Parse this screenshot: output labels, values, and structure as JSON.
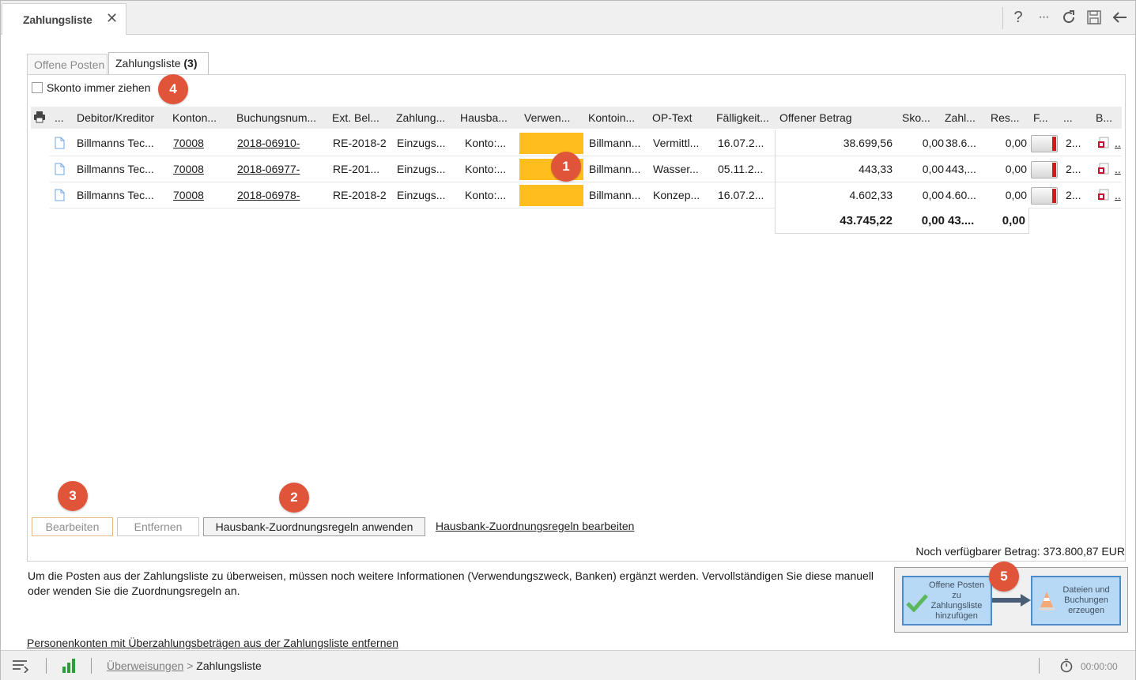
{
  "doc_tab": {
    "title": "Zahlungsliste",
    "close": "✕"
  },
  "toolbar": {
    "help": "?",
    "more": "···"
  },
  "inner_tabs": [
    {
      "label": "Offene Posten"
    },
    {
      "label": "Zahlungsliste",
      "count": "(3)"
    }
  ],
  "skonto_checkbox": {
    "label": "Skonto immer ziehen",
    "checked": false
  },
  "badges": [
    "1",
    "2",
    "3",
    "4",
    "5"
  ],
  "grid": {
    "columns": [
      "...",
      "Debitor/Kreditor",
      "Konton...",
      "Buchungsnum...",
      "Ext. Bel...",
      "Zahlung...",
      "Hausba...",
      "Verwen...",
      "Kontoin...",
      "OP-Text",
      "Fälligkeit...",
      "Offener Betrag",
      "Sko...",
      "Zahl...",
      "Res...",
      "F...",
      "...",
      "B..."
    ],
    "rows": [
      {
        "debitor": "Billmanns Tec...",
        "konto": "70008",
        "buchung": "2018-06910-",
        "extbel": "RE-2018-2",
        "zahlung": "Einzugs...",
        "hausbank": "Konto:...",
        "kontoin": "Billmann...",
        "optext": "Vermittl...",
        "faellig": "16.07.2...",
        "offen": "38.699,56",
        "skonto": "0,00",
        "zahl": "38.6...",
        "rest": "0,00",
        "dots": "2...",
        "ell": ".."
      },
      {
        "debitor": "Billmanns Tec...",
        "konto": "70008",
        "buchung": "2018-06977-",
        "extbel": "RE-201...",
        "zahlung": "Einzugs...",
        "hausbank": "Konto:...",
        "kontoin": "Billmann...",
        "optext": "Wasser...",
        "faellig": "05.11.2...",
        "offen": "443,33",
        "skonto": "0,00",
        "zahl": "443,...",
        "rest": "0,00",
        "dots": "2...",
        "ell": ".."
      },
      {
        "debitor": "Billmanns Tec...",
        "konto": "70008",
        "buchung": "2018-06978-",
        "extbel": "RE-2018-2",
        "zahlung": "Einzugs...",
        "hausbank": "Konto:...",
        "kontoin": "Billmann...",
        "optext": "Konzep...",
        "faellig": "16.07.2...",
        "offen": "4.602,33",
        "skonto": "0,00",
        "zahl": "4.60...",
        "rest": "0,00",
        "dots": "2...",
        "ell": ".."
      }
    ],
    "totals": {
      "offen": "43.745,22",
      "skonto": "0,00",
      "zahl": "43....",
      "rest": "0,00"
    }
  },
  "buttons": {
    "edit": "Bearbeiten",
    "remove": "Entfernen",
    "apply_rules": "Hausbank-Zuordnungsregeln anwenden",
    "edit_rules": "Hausbank-Zuordnungsregeln bearbeiten"
  },
  "available": "Noch verfügbarer Betrag: 373.800,87 EUR",
  "info_text": "Um die Posten aus der Zahlungsliste zu überweisen, müssen noch weitere Informationen (Verwendungszweck, Banken) ergänzt werden. Vervollständigen Sie diese manuell oder wenden Sie die Zuordnungsregeln an.",
  "wizard": {
    "step1": "Offene Posten zu Zahlungsliste hinzufügen",
    "step2": "Dateien und Buchungen erzeugen"
  },
  "bottom_link": "Personenkonten mit Überzahlungsbeträgen aus der Zahlungsliste entfernen",
  "statusbar": {
    "crumb1": "Überweisungen",
    "crumb_sep": ">",
    "crumb2": "Zahlungsliste",
    "timer": "00:00:00"
  },
  "colors": {
    "verwendung_fill": "#ffbe1e",
    "badge": "#e0553a",
    "wizard_step": "#b8d9f5"
  }
}
